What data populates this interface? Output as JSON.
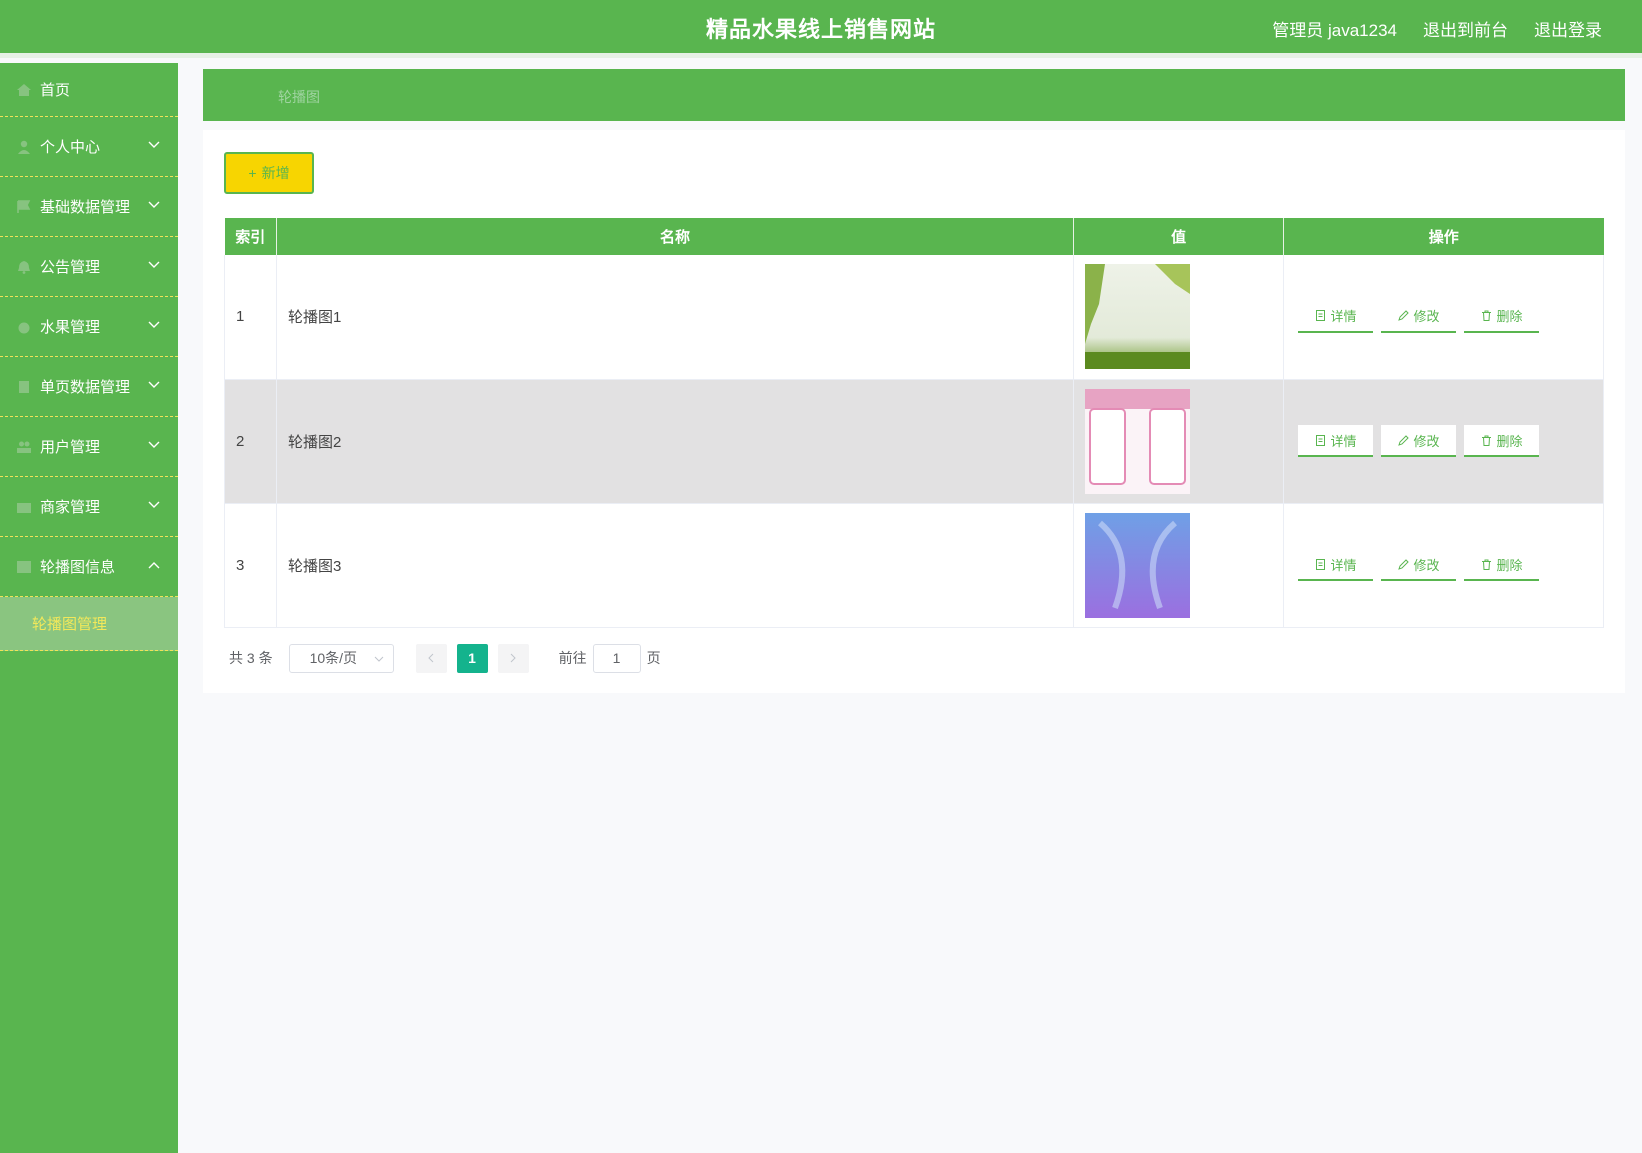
{
  "header": {
    "title": "精品水果线上销售网站",
    "user": "管理员 java1234",
    "to_front": "退出到前台",
    "logout": "退出登录"
  },
  "sidebar": {
    "items": [
      {
        "label": "首页",
        "icon": "home-icon",
        "expandable": false
      },
      {
        "label": "个人中心",
        "icon": "user-icon",
        "expandable": true
      },
      {
        "label": "基础数据管理",
        "icon": "flag-icon",
        "expandable": true
      },
      {
        "label": "公告管理",
        "icon": "bell-icon",
        "expandable": true
      },
      {
        "label": "水果管理",
        "icon": "fruit-icon",
        "expandable": true
      },
      {
        "label": "单页数据管理",
        "icon": "page-icon",
        "expandable": true
      },
      {
        "label": "用户管理",
        "icon": "users-icon",
        "expandable": true
      },
      {
        "label": "商家管理",
        "icon": "shop-icon",
        "expandable": true
      },
      {
        "label": "轮播图信息",
        "icon": "image-icon",
        "expandable": true,
        "expanded": true
      }
    ],
    "submenu": "轮播图管理",
    "accent": "#f2e85a"
  },
  "breadcrumb": "轮播图",
  "toolbar": {
    "add_label": "新增"
  },
  "table": {
    "headers": [
      "索引",
      "名称",
      "值",
      "操作"
    ],
    "rows": [
      {
        "index": "1",
        "name": "轮播图1",
        "image": "green-tree-banner"
      },
      {
        "index": "2",
        "name": "轮播图2",
        "image": "pink-frame-banner"
      },
      {
        "index": "3",
        "name": "轮播图3",
        "image": "blue-purple-banner"
      }
    ],
    "actions": {
      "detail": "详情",
      "edit": "修改",
      "delete": "删除"
    }
  },
  "pagination": {
    "total": "共 3 条",
    "page_size": "10条/页",
    "current": "1",
    "goto_label": "前往",
    "goto_value": "1",
    "page_suffix": "页"
  },
  "colors": {
    "primary": "#59b54f",
    "add_button": "#f7d501",
    "active_page": "#14b38d"
  }
}
